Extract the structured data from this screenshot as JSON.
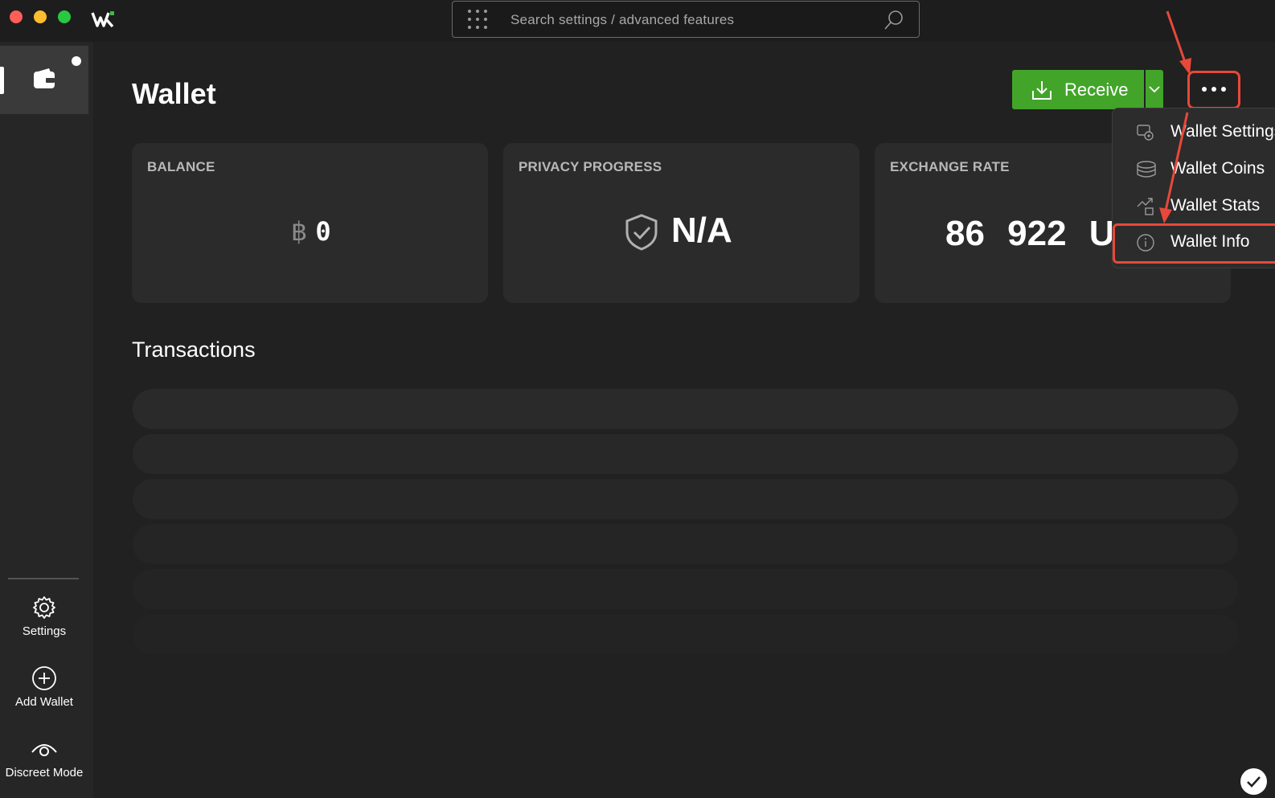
{
  "search": {
    "placeholder": "Search settings / advanced features"
  },
  "sidebar": {
    "items": [
      {
        "label": "Settings"
      },
      {
        "label": "Add Wallet"
      },
      {
        "label": "Discreet Mode"
      }
    ]
  },
  "header": {
    "title": "Wallet"
  },
  "actions": {
    "receive_label": "Receive"
  },
  "cards": {
    "balance": {
      "label": "BALANCE",
      "symbol": "฿",
      "value": "0"
    },
    "privacy": {
      "label": "PRIVACY PROGRESS",
      "value": "N/A"
    },
    "exchange": {
      "label": "EXCHANGE RATE",
      "value": "86 922 U"
    }
  },
  "transactions": {
    "title": "Transactions"
  },
  "menu": {
    "items": [
      {
        "label": "Wallet Settings"
      },
      {
        "label": "Wallet Coins"
      },
      {
        "label": "Wallet Stats"
      },
      {
        "label": "Wallet Info"
      }
    ]
  },
  "colors": {
    "accent_green": "#42a52a",
    "highlight_red": "#e8483a",
    "background": "#212121"
  }
}
